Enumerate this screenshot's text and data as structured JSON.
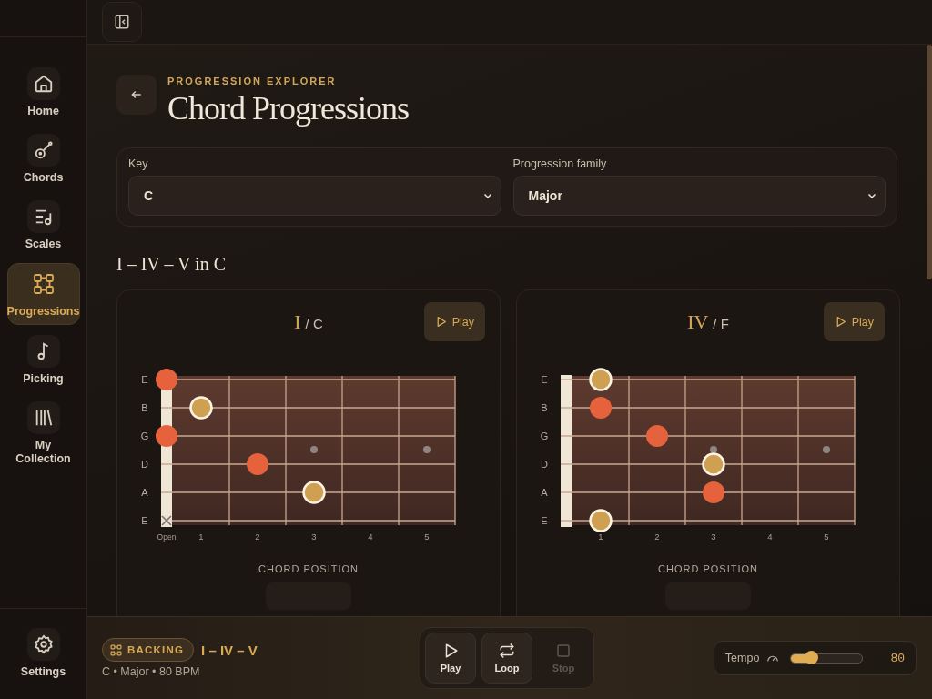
{
  "sidebar": {
    "items": [
      {
        "kind": "home",
        "label": "Home",
        "selected": false
      },
      {
        "kind": "chords",
        "label": "Chords",
        "selected": false
      },
      {
        "kind": "scales",
        "label": "Scales",
        "selected": false
      },
      {
        "kind": "progressions",
        "label": "Progressions",
        "selected": true
      },
      {
        "kind": "picking",
        "label": "Picking",
        "selected": false
      },
      {
        "kind": "collection",
        "label": "My Collection",
        "selected": false
      }
    ],
    "settings": {
      "label": "Settings"
    }
  },
  "header": {
    "eyebrow": "PROGRESSION EXPLORER",
    "title": "Chord Progressions"
  },
  "filters": [
    {
      "label": "Key",
      "value": "C"
    },
    {
      "label": "Progression family",
      "value": "Major"
    }
  ],
  "section_title": "I – IV – V in C",
  "cards": [
    {
      "numeral": "I",
      "chord": "/ C",
      "play": "Play",
      "caption": "CHORD POSITION",
      "fret_labels": [
        "Open",
        "1",
        "2",
        "3",
        "4",
        "5"
      ],
      "strings": [
        {
          "name": "E",
          "frets": [
            {
              "kind": "root"
            },
            {
              "kind": "empty"
            },
            {
              "kind": "empty"
            },
            {
              "kind": "empty"
            },
            {
              "kind": "empty"
            },
            {
              "kind": "empty"
            }
          ]
        },
        {
          "name": "B",
          "frets": [
            {
              "kind": "empty"
            },
            {
              "kind": "tone"
            },
            {
              "kind": "empty"
            },
            {
              "kind": "empty"
            },
            {
              "kind": "empty"
            },
            {
              "kind": "empty"
            }
          ]
        },
        {
          "name": "G",
          "frets": [
            {
              "kind": "root"
            },
            {
              "kind": "empty"
            },
            {
              "kind": "empty"
            },
            {
              "kind": "empty"
            },
            {
              "kind": "empty"
            },
            {
              "kind": "empty"
            }
          ]
        },
        {
          "name": "D",
          "frets": [
            {
              "kind": "empty"
            },
            {
              "kind": "empty"
            },
            {
              "kind": "root"
            },
            {
              "kind": "empty"
            },
            {
              "kind": "empty"
            },
            {
              "kind": "empty"
            }
          ]
        },
        {
          "name": "A",
          "frets": [
            {
              "kind": "empty"
            },
            {
              "kind": "empty"
            },
            {
              "kind": "empty"
            },
            {
              "kind": "tone"
            },
            {
              "kind": "empty"
            },
            {
              "kind": "empty"
            }
          ]
        },
        {
          "name": "E",
          "frets": [
            {
              "kind": "muted"
            },
            {
              "kind": "empty"
            },
            {
              "kind": "empty"
            },
            {
              "kind": "empty"
            },
            {
              "kind": "empty"
            },
            {
              "kind": "empty"
            }
          ]
        }
      ]
    },
    {
      "numeral": "IV",
      "chord": "/ F",
      "play": "Play",
      "caption": "CHORD POSITION",
      "fret_labels": [
        "1",
        "2",
        "3",
        "4",
        "5"
      ],
      "strings": [
        {
          "name": "E",
          "frets": [
            {
              "kind": "empty"
            },
            {
              "kind": "tone"
            },
            {
              "kind": "empty"
            },
            {
              "kind": "empty"
            },
            {
              "kind": "empty"
            },
            {
              "kind": "empty"
            }
          ]
        },
        {
          "name": "B",
          "frets": [
            {
              "kind": "empty"
            },
            {
              "kind": "root"
            },
            {
              "kind": "empty"
            },
            {
              "kind": "empty"
            },
            {
              "kind": "empty"
            },
            {
              "kind": "empty"
            }
          ]
        },
        {
          "name": "G",
          "frets": [
            {
              "kind": "empty"
            },
            {
              "kind": "empty"
            },
            {
              "kind": "root"
            },
            {
              "kind": "empty"
            },
            {
              "kind": "empty"
            },
            {
              "kind": "empty"
            }
          ]
        },
        {
          "name": "D",
          "frets": [
            {
              "kind": "empty"
            },
            {
              "kind": "empty"
            },
            {
              "kind": "empty"
            },
            {
              "kind": "tone"
            },
            {
              "kind": "empty"
            },
            {
              "kind": "empty"
            }
          ]
        },
        {
          "name": "A",
          "frets": [
            {
              "kind": "empty"
            },
            {
              "kind": "empty"
            },
            {
              "kind": "empty"
            },
            {
              "kind": "root"
            },
            {
              "kind": "empty"
            },
            {
              "kind": "empty"
            }
          ]
        },
        {
          "name": "E",
          "frets": [
            {
              "kind": "empty"
            },
            {
              "kind": "tone"
            },
            {
              "kind": "empty"
            },
            {
              "kind": "empty"
            },
            {
              "kind": "empty"
            },
            {
              "kind": "empty"
            }
          ]
        }
      ]
    }
  ],
  "footer": {
    "badge": "BACKING",
    "title": "I – IV – V",
    "subtitle": "C • Major • 80 BPM",
    "transport": [
      {
        "kind": "play",
        "label": "Play",
        "disabled": false
      },
      {
        "kind": "loop",
        "label": "Loop",
        "disabled": false
      },
      {
        "kind": "stop",
        "label": "Stop",
        "disabled": true
      }
    ],
    "tempo": {
      "label": "Tempo",
      "level": 0.28,
      "value": "80"
    }
  }
}
